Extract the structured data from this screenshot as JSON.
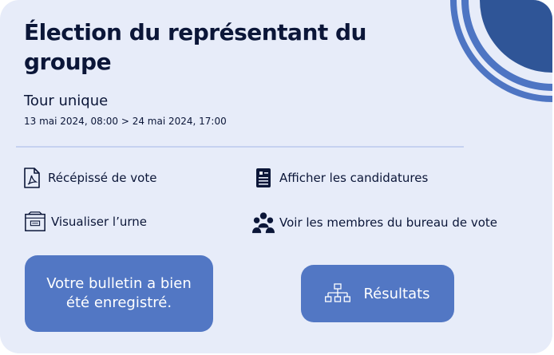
{
  "election": {
    "title": "Élection du représentant du groupe",
    "round": "Tour unique",
    "dates": "13 mai 2024, 08:00 > 24 mai 2024, 17:00"
  },
  "actions": {
    "receipt": "Récépissé de vote",
    "candidates": "Afficher les candidatures",
    "ballot_box": "Visualiser l’urne",
    "members": "Voir les membres du bureau de vote"
  },
  "vote_status": "Votre bulletin a bien été enregistré.",
  "results_button": "Résultats",
  "colors": {
    "card_bg": "#e7ecf9",
    "accent": "#5277c4",
    "accent_dark": "#2f5597",
    "text": "#0b1638"
  }
}
